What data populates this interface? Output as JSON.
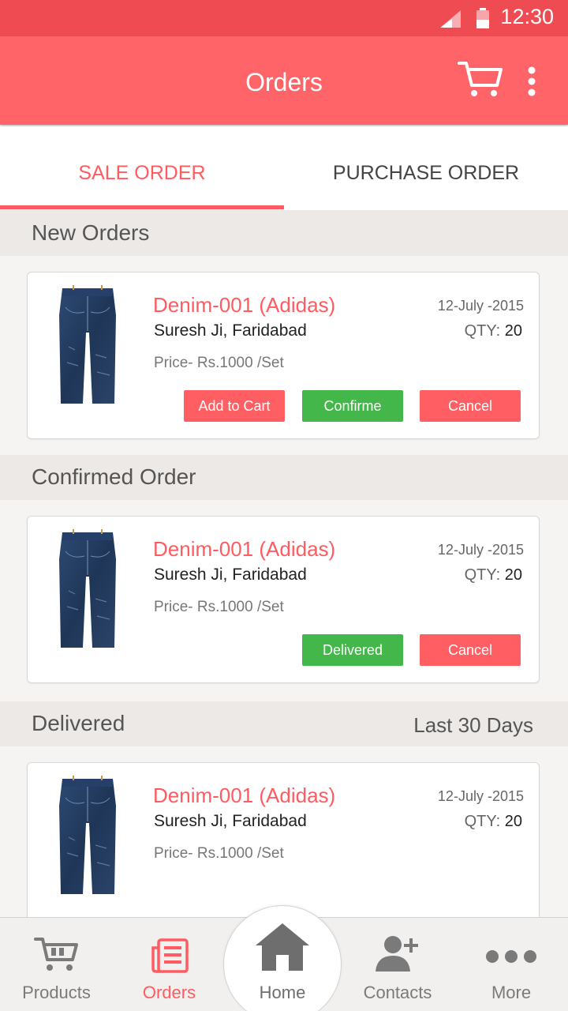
{
  "status_bar": {
    "time": "12:30"
  },
  "app_bar": {
    "title": "Orders"
  },
  "tabs": [
    {
      "label": "SALE ORDER",
      "active": true
    },
    {
      "label": "PURCHASE ORDER",
      "active": false
    }
  ],
  "sections": {
    "new": {
      "title": "New Orders",
      "order": {
        "product": "Denim-001 (Adidas)",
        "customer": "Suresh Ji, Faridabad",
        "price": "Price- Rs.1000 /Set",
        "date": "12-July -2015",
        "qty_label": "QTY:",
        "qty_value": "20",
        "buttons": {
          "add_to_cart": "Add to Cart",
          "confirm": "Confirme",
          "cancel": "Cancel"
        }
      }
    },
    "confirmed": {
      "title": "Confirmed Order",
      "order": {
        "product": "Denim-001 (Adidas)",
        "customer": "Suresh Ji, Faridabad",
        "price": "Price- Rs.1000 /Set",
        "date": "12-July -2015",
        "qty_label": "QTY:",
        "qty_value": "20",
        "buttons": {
          "delivered": "Delivered",
          "cancel": "Cancel"
        }
      }
    },
    "delivered": {
      "title": "Delivered",
      "filter": "Last 30 Days",
      "order": {
        "product": "Denim-001 (Adidas)",
        "customer": "Suresh Ji, Faridabad",
        "price": "Price- Rs.1000 /Set",
        "date": "12-July -2015",
        "qty_label": "QTY:",
        "qty_value": "20"
      }
    }
  },
  "bottom_nav": {
    "products": "Products",
    "orders": "Orders",
    "home": "Home",
    "contacts": "Contacts",
    "more": "More"
  },
  "colors": {
    "accent": "#ff6468",
    "status_bar": "#ee4b53",
    "confirm_green": "#44b74a",
    "cancel_red": "#ff5e63"
  }
}
